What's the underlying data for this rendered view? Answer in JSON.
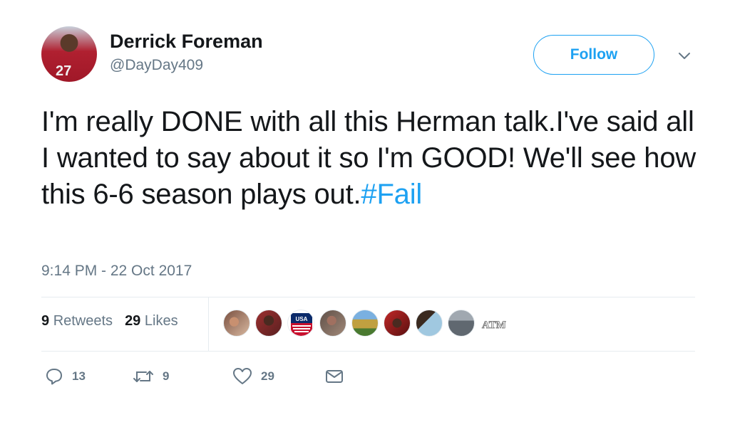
{
  "tweet": {
    "author": {
      "name": "Derrick Foreman",
      "handle": "@DayDay409",
      "avatar_text": "27"
    },
    "follow_label": "Follow",
    "text": "I'm really DONE with all this Herman talk.I've said all I wanted to say about it so I'm GOOD! We'll see how this 6-6 season plays out.",
    "hashtag": "#Fail",
    "timestamp": "9:14 PM - 22 Oct 2017",
    "stats": {
      "retweets_count": "9",
      "retweets_label": "Retweets",
      "likes_count": "29",
      "likes_label": "Likes"
    },
    "liker_avatars": [
      "avatar",
      "avatar",
      "usa-soccer-logo",
      "avatar",
      "avatar",
      "avatar",
      "avatar",
      "avatar",
      "texas-am-logo"
    ],
    "usa_logo_text": "USA",
    "atm_logo_text": "ATM",
    "actions": {
      "reply_count": "13",
      "retweet_count": "9",
      "like_count": "29"
    },
    "colors": {
      "accent": "#1da1f2",
      "text": "#14171a",
      "secondary": "#657786"
    }
  }
}
